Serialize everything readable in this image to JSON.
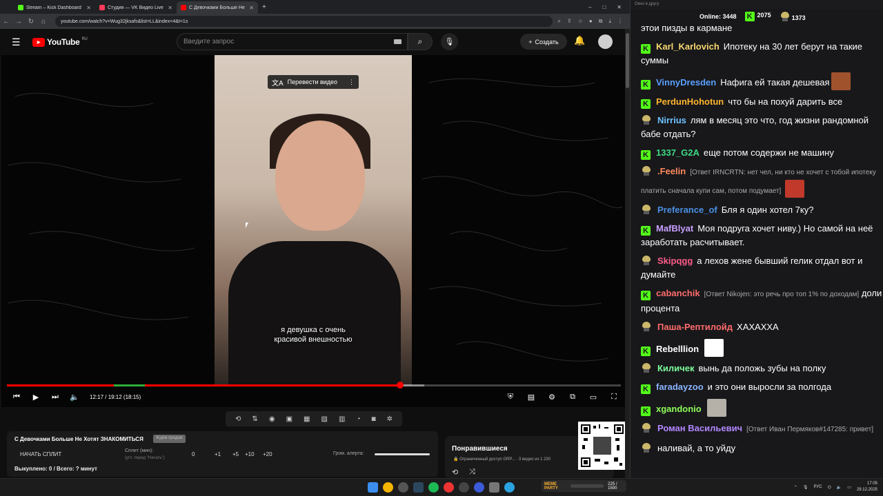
{
  "browser": {
    "tabs": [
      {
        "label": "Stream – Kick Dashboard",
        "color": "#53fc18"
      },
      {
        "label": "Студия — VK Видео Live",
        "color": "#ff3b5c"
      },
      {
        "label": "С Девочками Больше Не Хо",
        "color": "#ff0000"
      }
    ],
    "url": "youtube.com/watch?v=Wug32jksafs&list=LL&index=4&t=1s"
  },
  "youtube": {
    "logo": "YouTube",
    "region": "RU",
    "search_placeholder": "Введите запрос",
    "create_label": "Создать"
  },
  "player": {
    "translate_label": "Перевести видео",
    "subtitle_line1": "я девушка с очень",
    "subtitle_line2": "красивой внешностью",
    "time": "12:17 / 19:12 (18:15)",
    "progress": 0.64
  },
  "panel": {
    "title": "С Девочками Больше Не Хотят ЗНАКОМИТЬСЯ",
    "badge": "Ждём продаж",
    "split_button": "НАЧАТЬ СПЛИТ",
    "split_label": "Сплит (мин):",
    "split_hint": "(уст. перед \"Начать\")",
    "split_value": "0",
    "inc": [
      "+1",
      "+5",
      "+10",
      "+20"
    ],
    "volume_label": "Гром. алерта:",
    "bought": "Выкуплено: 0 / Всего: ? минут"
  },
  "liked": {
    "title": "Понравившиеся",
    "sub": "Ограниченный доступ GRP...",
    "count": "3 видео из 1 230"
  },
  "chat": {
    "online_label": "Online:",
    "online": "3448",
    "kick_count": "2075",
    "vk_count": "1373",
    "window_title": "Окно в другу",
    "messages": [
      {
        "src": "none",
        "name": "",
        "color": "#fff",
        "text": "этои пизды в кармане"
      },
      {
        "src": "kick",
        "name": "Karl_Karlovich",
        "color": "#f5d76e",
        "text": "Ипотеку на 30 лет берут на такие суммы"
      },
      {
        "src": "kick",
        "name": "VinnyDresden",
        "color": "#5aa0ff",
        "text": "Нафига ей такая дешевая",
        "emote": "#a0522d"
      },
      {
        "src": "kick",
        "name": "PerdunHohotun",
        "color": "#ffb52e",
        "text": "что бы на похуй дарить все"
      },
      {
        "src": "vk",
        "name": "Nirrius",
        "color": "#6ec3ff",
        "text": "лям в месяц это что, год жизни рандомной бабе отдать?"
      },
      {
        "src": "kick",
        "name": "1337_G2A",
        "color": "#3ddc84",
        "text": "еще потом содержи не машину"
      },
      {
        "src": "vk",
        "name": ".Feelin",
        "color": "#ff8a5c",
        "reply": "[Ответ IRNCRTN: нет чел, ни кто не хочет с тобой ипотеку платить сначала купи сам, потом подумает]",
        "text": "",
        "emote": "#c0392b"
      },
      {
        "src": "vk",
        "name": "Preferance_of",
        "color": "#4a90e2",
        "text": "Бля я один хотел 7ку?"
      },
      {
        "src": "kick",
        "name": "MafBlyat",
        "color": "#c8a0ff",
        "text": "Моя подруга хочет ниву.) Но самой на неё заработать расчитывает."
      },
      {
        "src": "vk",
        "name": "Skipqgg",
        "color": "#ff5c8a",
        "text": "а лехов жене бывший гелик отдал вот и думайте"
      },
      {
        "src": "kick",
        "name": "cabanchik",
        "color": "#ff6b6b",
        "reply": "[Ответ Nikojen: это речь про топ 1% по доходам]",
        "text": "доли процента"
      },
      {
        "src": "vk",
        "name": "Паша-Рептилойд",
        "color": "#ff6b6b",
        "text": "ХАХАХХА"
      },
      {
        "src": "kick",
        "name": "Rebelllion",
        "color": "#ffffff",
        "text": "",
        "emote": "#ffffff"
      },
      {
        "src": "vk",
        "name": "Киличек",
        "color": "#7dff9a",
        "text": "вынь да положь зубы на полку"
      },
      {
        "src": "kick",
        "name": "faradayzoo",
        "color": "#8ab4ff",
        "text": "и это они выросли за полгода"
      },
      {
        "src": "kick",
        "name": "xgandonio",
        "color": "#8fff5a",
        "text": "",
        "emote": "#b5b0a8"
      },
      {
        "src": "vk",
        "name": "Роман Васильевич",
        "color": "#b388ff",
        "reply": "[Ответ Иван Пермяков#147285: привет]",
        "text": ""
      },
      {
        "src": "vk",
        "name": "",
        "color": "#fff",
        "text": "наливай, а то уйду"
      }
    ]
  },
  "taskbar": {
    "meme_label": "MEME PARTY",
    "meme_progress": "225 / 1500",
    "lang": "РУС",
    "time": "17:05",
    "date": "29.12.2025"
  }
}
